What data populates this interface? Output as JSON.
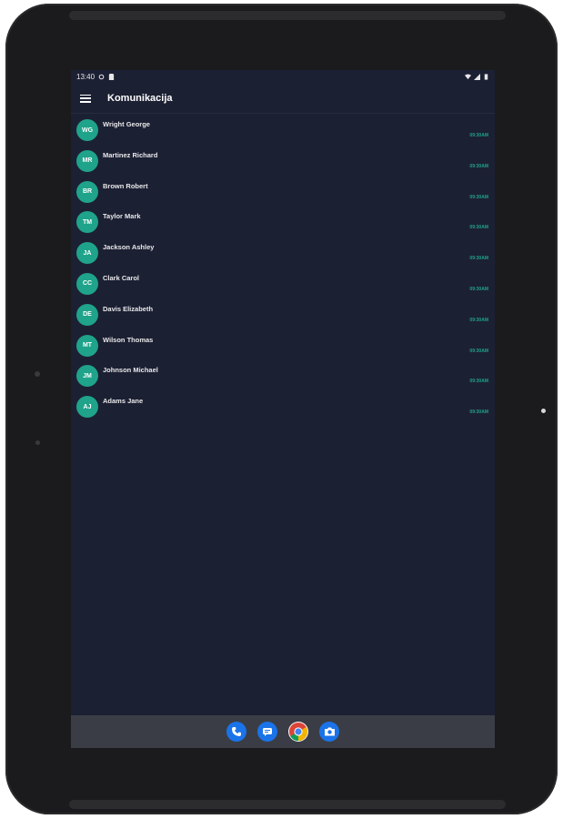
{
  "status_bar": {
    "time": "13:40"
  },
  "app_bar": {
    "title": "Komunikacija"
  },
  "contacts": [
    {
      "initials": "WG",
      "name": "Wright George",
      "time": "09:30AM"
    },
    {
      "initials": "MR",
      "name": "Martinez Richard",
      "time": "09:30AM"
    },
    {
      "initials": "BR",
      "name": "Brown Robert",
      "time": "09:30AM"
    },
    {
      "initials": "TM",
      "name": "Taylor Mark",
      "time": "09:30AM"
    },
    {
      "initials": "JA",
      "name": "Jackson Ashley",
      "time": "09:30AM"
    },
    {
      "initials": "CC",
      "name": "Clark Carol",
      "time": "09:30AM"
    },
    {
      "initials": "DE",
      "name": "Davis Elizabeth",
      "time": "09:30AM"
    },
    {
      "initials": "MT",
      "name": "Wilson Thomas",
      "time": "09:30AM"
    },
    {
      "initials": "JM",
      "name": "Johnson Michael",
      "time": "09:30AM"
    },
    {
      "initials": "AJ",
      "name": "Adams Jane",
      "time": "09:30AM"
    }
  ],
  "dock": [
    "phone-app",
    "messages-app",
    "chrome-app",
    "camera-app"
  ],
  "colors": {
    "accent": "#1fa38a",
    "background": "#1c2033",
    "dock": "#3a3d45"
  }
}
